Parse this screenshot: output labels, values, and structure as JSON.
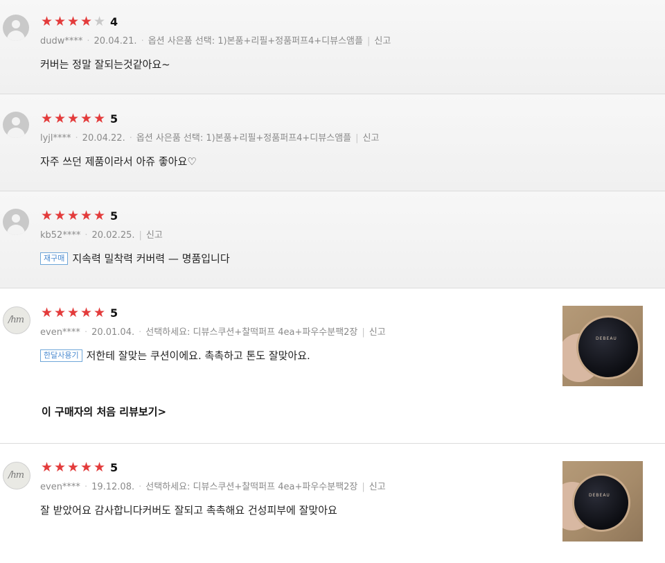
{
  "reviews": [
    {
      "stars": 4,
      "score": "4",
      "user": "dudw****",
      "date": "20.04.21.",
      "option": "옵션 사은품 선택: 1)본품+리필+정품퍼프4+디뷰스앰플",
      "report": "신고",
      "text": "커버는 정말 잘되는것같아요~"
    },
    {
      "stars": 5,
      "score": "5",
      "user": "lyjl****",
      "date": "20.04.22.",
      "option": "옵션 사은품 선택: 1)본품+리필+정품퍼프4+디뷰스앰플",
      "report": "신고",
      "text": "자주 쓰던 제품이라서 아쥬 좋아요♡"
    },
    {
      "stars": 5,
      "score": "5",
      "user": "kb52****",
      "date": "20.02.25.",
      "report": "신고",
      "badge": "재구매",
      "text": "지속력 밀착력 커버력 — 명품입니다"
    },
    {
      "stars": 5,
      "score": "5",
      "user": "even****",
      "date": "20.01.04.",
      "option": "선택하세요: 디뷰스쿠션+찰떡퍼프 4ea+파우수분팩2장",
      "report": "신고",
      "badge": "한달사용기",
      "text": "저한테 잘맞는 쿠션이에요. 촉촉하고 톤도 잘맞아요.",
      "first_review_link": "이 구매자의 처음 리뷰보기>"
    },
    {
      "stars": 5,
      "score": "5",
      "user": "even****",
      "date": "19.12.08.",
      "option": "선택하세요: 디뷰스쿠션+찰떡퍼프 4ea+파우수분팩2장",
      "report": "신고",
      "text": "잘 받았어요 감사합니다커버도 잘되고 촉촉해요 건성피부에 잘맞아요"
    }
  ],
  "icons": {
    "avatar_default": "user-silhouette-icon",
    "avatar_photo": "user-photo-icon",
    "star": "star-icon"
  },
  "colors": {
    "star_on": "#e33b3b",
    "star_off": "#c9c9c9",
    "badge": "#4a8ad0"
  }
}
